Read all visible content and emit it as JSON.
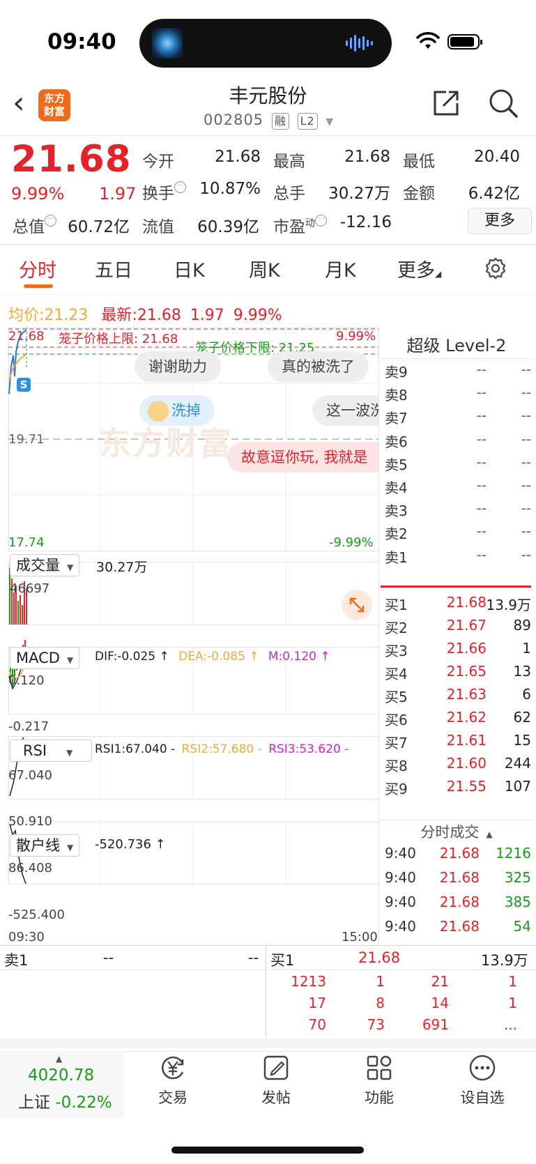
{
  "status_bar": {
    "time": "09:40"
  },
  "header": {
    "logo_line1": "东方",
    "logo_line2": "财富",
    "stock_name": "丰元股份",
    "stock_code": "002805",
    "tag_margin": "融",
    "tag_level": "L2"
  },
  "quote": {
    "price": "21.68",
    "change_pct": "9.99%",
    "change": "1.97",
    "open_label": "今开",
    "open": "21.68",
    "high_label": "最高",
    "high": "21.68",
    "low_label": "最低",
    "low": "20.40",
    "turnover_label": "换手",
    "turnover": "10.87%",
    "volume_label": "总手",
    "volume": "30.27万",
    "amount_label": "金额",
    "amount": "6.42亿",
    "mktcap_label": "总值",
    "mktcap": "60.72亿",
    "float_label": "流值",
    "float": "60.39亿",
    "pe_label": "市盈",
    "pe_sup": "动",
    "pe": "-12.16",
    "more_label": "更多"
  },
  "tabs": [
    "分时",
    "五日",
    "日K",
    "周K",
    "月K",
    "更多"
  ],
  "active_tab": "分时",
  "intraday": {
    "avg_label": "均价:",
    "avg": "21.23",
    "latest_label": "最新:",
    "latest": "21.68",
    "latest_chg": "1.97",
    "latest_pct": "9.99%",
    "price_top": "21.68",
    "upper_limit_label": "笼子价格上限: 21.68",
    "pct_top": "9.99%",
    "lower_limit_label": "笼子价格下限: 21.25",
    "pre_close": "19.71",
    "price_bottom": "17.74",
    "pct_bottom": "-9.99%",
    "danmu": [
      "谢谢助力",
      "真的被洗了",
      "洗掉",
      "这一波洗",
      "故意逗你玩, 我就是"
    ],
    "watermark": "东方财富",
    "s_badge": "S"
  },
  "volume_panel": {
    "label": "成交量",
    "value": "30.27万",
    "axis_max": "46697"
  },
  "macd_panel": {
    "label": "MACD",
    "dif": "DIF:-0.025 ↑",
    "dea": "DEA:-0.085 ↑",
    "m": "M:0.120 ↑",
    "axis_max": "0.120",
    "axis_min": "-0.217"
  },
  "rsi_panel": {
    "label": "RSI",
    "rsi1": "RSI1:67.040 -",
    "rsi2": "RSI2:57.680 -",
    "rsi3": "RSI3:53.620 -",
    "axis_max": "67.040",
    "axis_min": "50.910"
  },
  "retail_panel": {
    "label": "散户线",
    "value": "-520.736 ↑",
    "axis_max": "86.408",
    "axis_min": "-525.400"
  },
  "time_axis": {
    "start": "09:30",
    "end": "15:00"
  },
  "level2": {
    "title": "超级 Level-2",
    "asks": [
      {
        "label": "卖9",
        "price": "--",
        "vol": "--"
      },
      {
        "label": "卖8",
        "price": "--",
        "vol": "--"
      },
      {
        "label": "卖7",
        "price": "--",
        "vol": "--"
      },
      {
        "label": "卖6",
        "price": "--",
        "vol": "--"
      },
      {
        "label": "卖5",
        "price": "--",
        "vol": "--"
      },
      {
        "label": "卖4",
        "price": "--",
        "vol": "--"
      },
      {
        "label": "卖3",
        "price": "--",
        "vol": "--"
      },
      {
        "label": "卖2",
        "price": "--",
        "vol": "--"
      },
      {
        "label": "卖1",
        "price": "--",
        "vol": "--"
      }
    ],
    "bids": [
      {
        "label": "买1",
        "price": "21.68",
        "vol": "13.9万"
      },
      {
        "label": "买2",
        "price": "21.67",
        "vol": "89"
      },
      {
        "label": "买3",
        "price": "21.66",
        "vol": "1"
      },
      {
        "label": "买4",
        "price": "21.65",
        "vol": "13"
      },
      {
        "label": "买5",
        "price": "21.63",
        "vol": "6"
      },
      {
        "label": "买6",
        "price": "21.62",
        "vol": "62"
      },
      {
        "label": "买7",
        "price": "21.61",
        "vol": "15"
      },
      {
        "label": "买8",
        "price": "21.60",
        "vol": "244"
      },
      {
        "label": "买9",
        "price": "21.55",
        "vol": "107"
      }
    ],
    "trades_title": "分时成交",
    "trades": [
      {
        "time": "9:40",
        "price": "21.68",
        "vol": "1216"
      },
      {
        "time": "9:40",
        "price": "21.68",
        "vol": "325"
      },
      {
        "time": "9:40",
        "price": "21.68",
        "vol": "385"
      },
      {
        "time": "9:40",
        "price": "21.68",
        "vol": "54"
      }
    ]
  },
  "queue": {
    "sell_label": "卖1",
    "sell_price": "--",
    "sell_vol": "--",
    "buy_label": "买1",
    "buy_price": "21.68",
    "buy_vol": "13.9万",
    "rows": [
      [
        "1213",
        "1",
        "21",
        "1"
      ],
      [
        "17",
        "8",
        "14",
        "1"
      ],
      [
        "70",
        "73",
        "691",
        "..."
      ]
    ]
  },
  "bottom_nav": {
    "index_value": "4020.78",
    "index_name": "上证",
    "index_change": "-0.22%",
    "items": [
      "交易",
      "发帖",
      "功能",
      "设自选"
    ]
  }
}
